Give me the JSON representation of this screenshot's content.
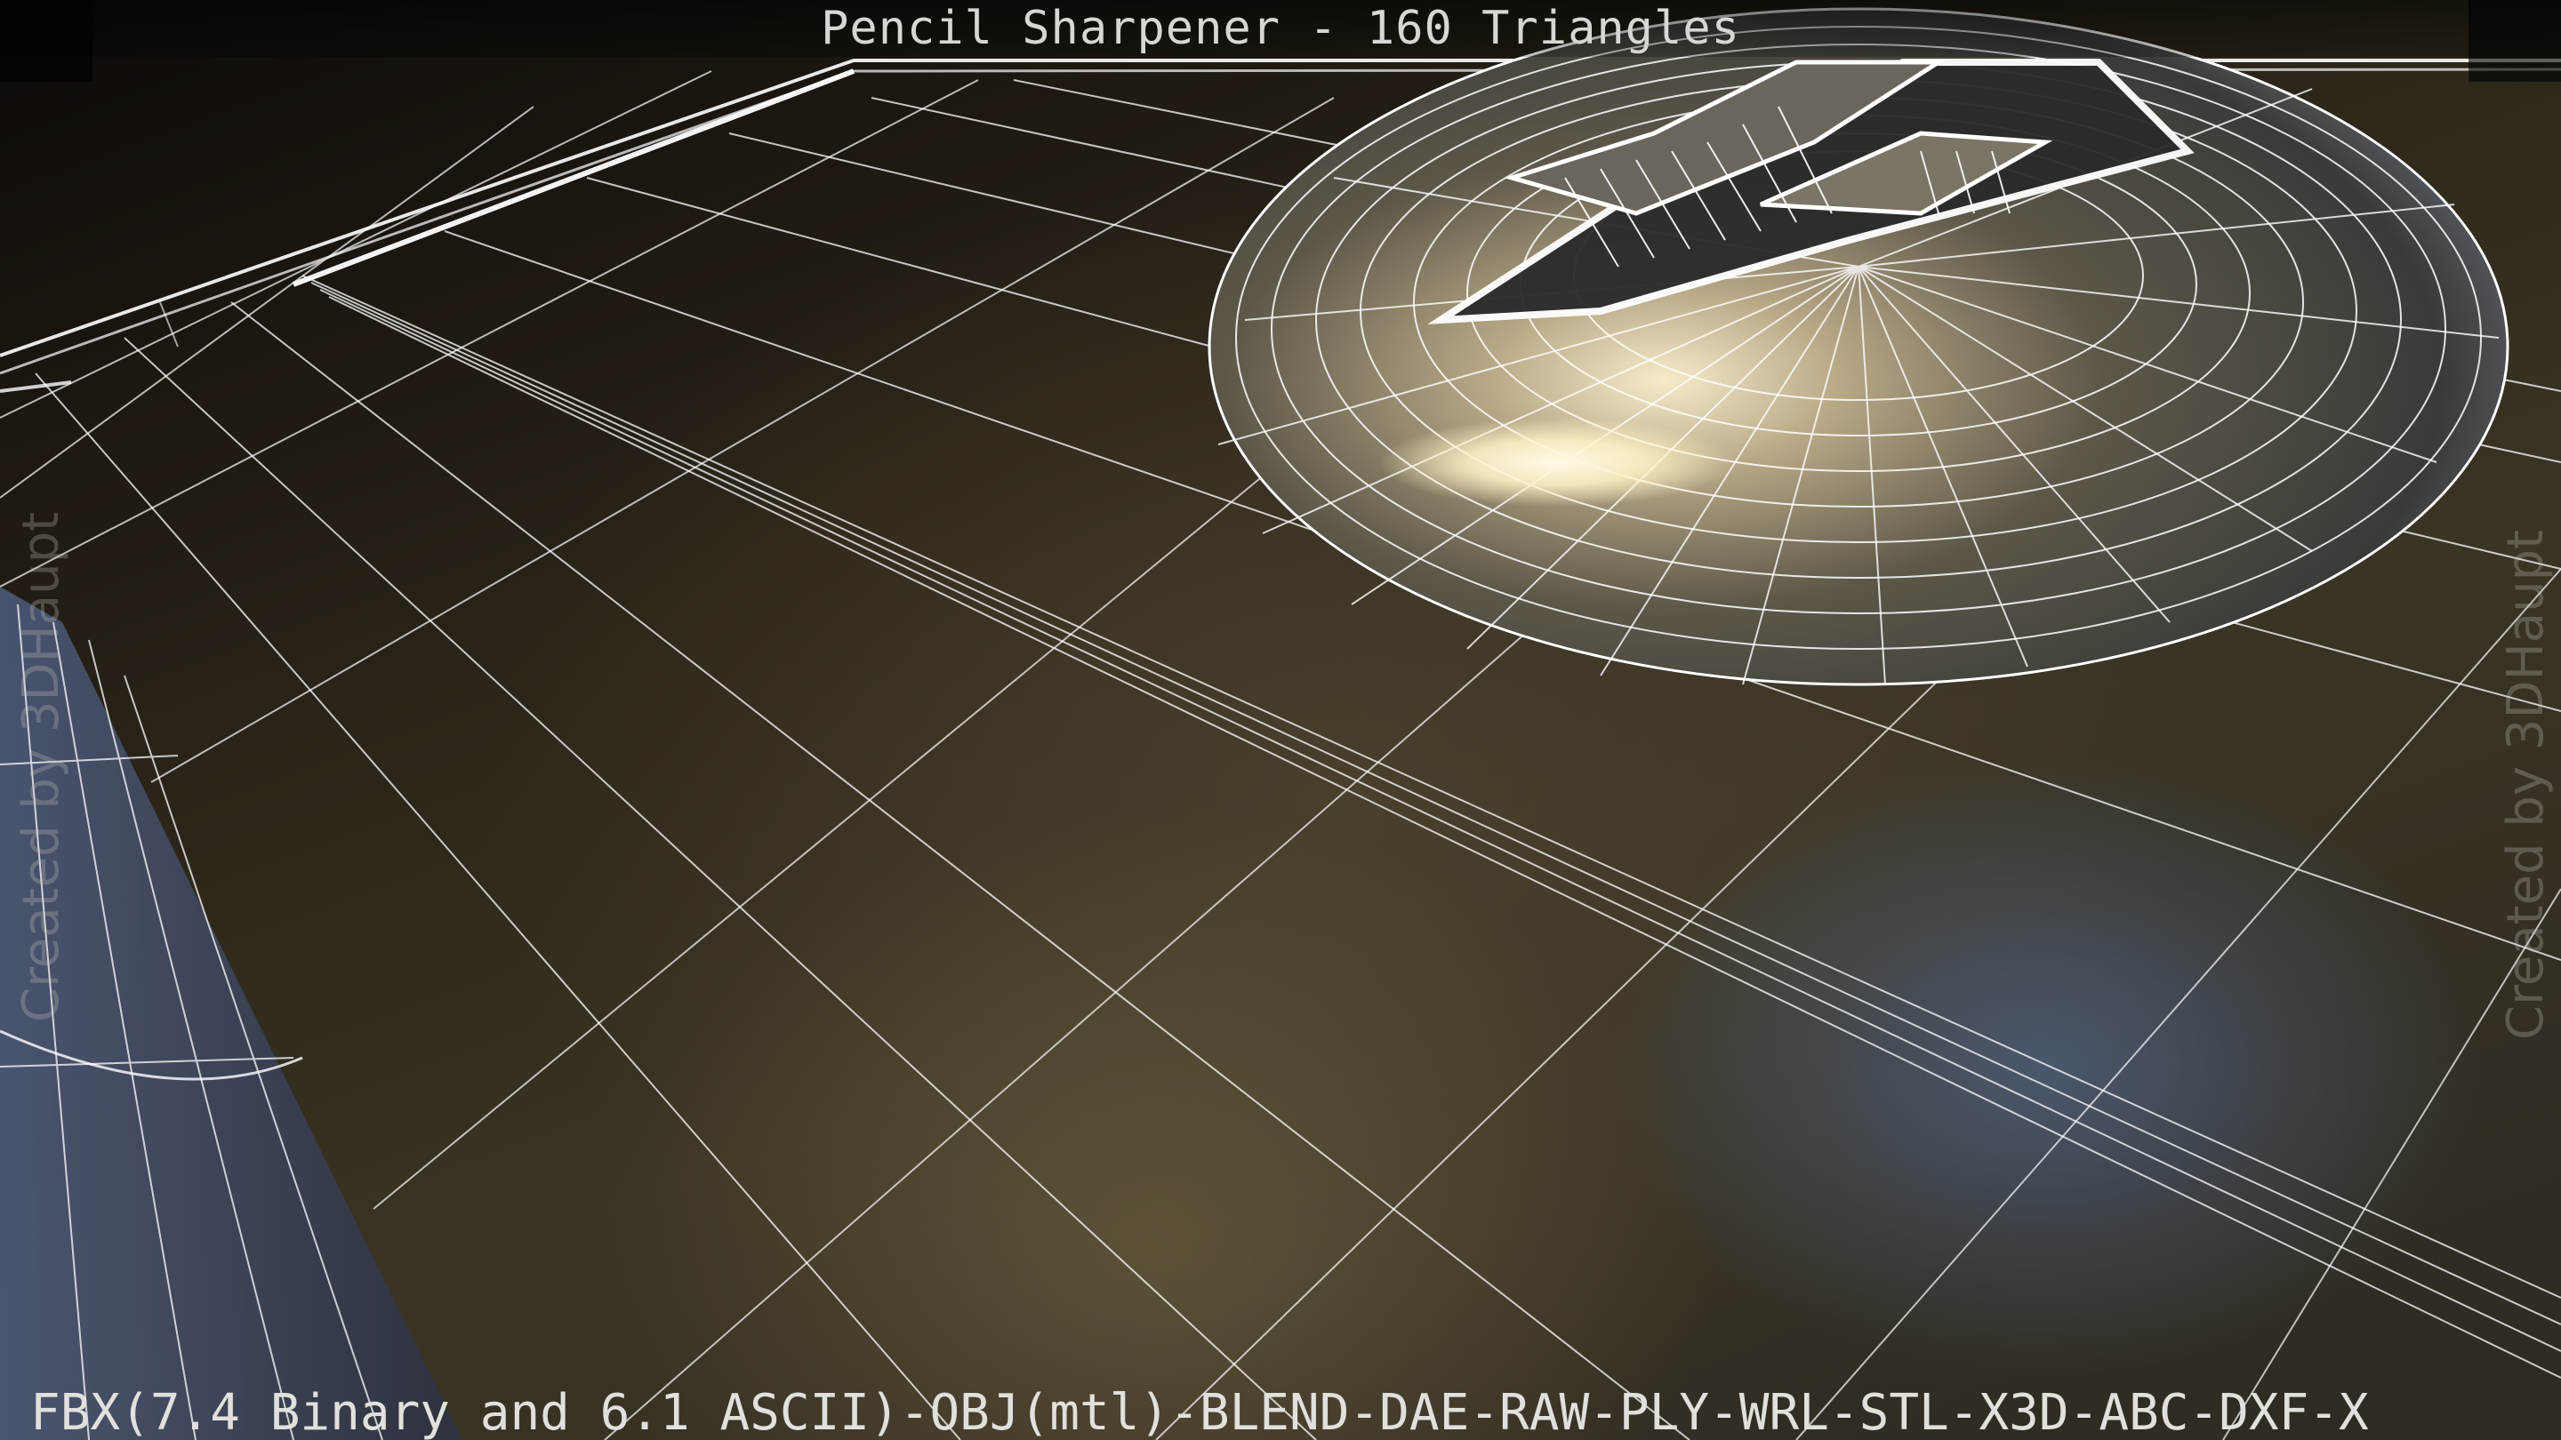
{
  "viewer": {
    "title": "Pencil Sharpener - 160 Triangles",
    "formats_footer": "FBX(7.4 Binary and 6.1 ASCII)-OBJ(mtl)-BLEND-DAE-RAW-PLY-WRL-STL-X3D-ABC-DXF-X",
    "watermark_left": "Created by 3DHaupt",
    "watermark_right": "Created by 3DHaupt"
  },
  "scene": {
    "object": "wireframe-pencil-sharpener",
    "surface": "wireframe-ground-plane",
    "wire_color": "#ffffff",
    "shading_colors": [
      "#3a3424",
      "#5b6f95",
      "#f2e7c8"
    ]
  }
}
